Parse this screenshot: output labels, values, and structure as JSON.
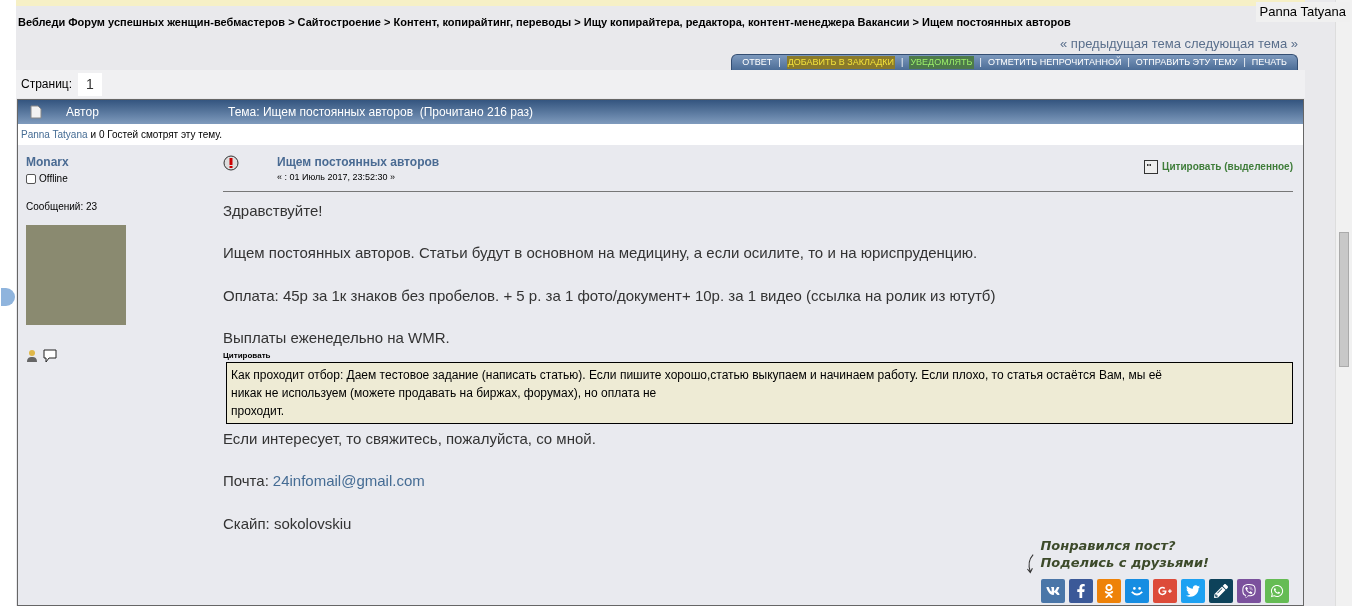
{
  "breadcrumb": "Вебледи Форум успешных женщин-вебмастеров > Сайтостроение > Контент, копирайтинг, переводы > Ищу копирайтера, редактора, контент-менеджера Вакансии > Ищем постоянных авторов",
  "tooltip": "Panna Tatyana",
  "topic_nav": "« предыдущая тема следующая тема »",
  "action_separator": "|",
  "actions": [
    {
      "label": "ОТВЕТ",
      "kind": "plain"
    },
    {
      "label": "ДОБАВИТЬ В ЗАКЛАДКИ",
      "kind": "bookmark"
    },
    {
      "label": "УВЕДОМЛЯТЬ",
      "kind": "notify"
    },
    {
      "label": "ОТМЕТИТЬ НЕПРОЧИТАННОЙ",
      "kind": "plain"
    },
    {
      "label": "ОТПРАВИТЬ ЭТУ ТЕМУ",
      "kind": "plain"
    },
    {
      "label": "ПЕЧАТЬ",
      "kind": "plain"
    }
  ],
  "pages": {
    "label": "Страниц:",
    "current": "1"
  },
  "table_header": {
    "author": "Автор",
    "topic": "Тема: Ищем постоянных авторов  (Прочитано 216 раз)"
  },
  "viewers": {
    "user": "Panna Tatyana",
    "rest": "и 0 Гостей смотрят эту тему."
  },
  "post": {
    "author": "Monarx",
    "online": false,
    "status": "Offline",
    "messages": "Сообщений: 23",
    "title": "Ищем постоянных авторов",
    "date": "« : 01 Июль 2017, 23:52:30 »",
    "quote_action": "Цитировать (выделенное)",
    "paragraphs": [
      "Здравствуйте!",
      "Ищем постоянных авторов. Статьи будут в основном на медицину, а если осилите, то и на юриспруденцию.",
      "Оплата: 45р за 1к знаков без пробелов. + 5 р. за 1 фото/документ+ 10р. за 1 видео (ссылка на ролик из ютутб)",
      "Выплаты еженедельно на WMR."
    ],
    "quote_label": "Цитировать",
    "quote_lines": [
      "Как проходит отбор: Даем тестовое задание (написать статью). Если пишите хорошо,статью выкупаем и начинаем работу. Если плохо, то статья остаётся Вам, мы её",
      "никак не используем (можете продавать на биржах, форумах), но оплата не",
      "проходит."
    ],
    "after": [
      "Если интересует, то свяжитесь, пожалуйста, со мной."
    ],
    "mail_label": "Почта:",
    "mail": "24infomail@gmail.com",
    "skype": "Скайп: sokolovskiu"
  },
  "share": {
    "caption_lines": [
      "Понравился пост?",
      "Поделись с друзьями!"
    ],
    "buttons": [
      {
        "kind": "vk",
        "color": "#4a76a8"
      },
      {
        "kind": "facebook",
        "color": "#3b5998"
      },
      {
        "kind": "odnoklassniki",
        "color": "#ee8208"
      },
      {
        "kind": "mailru",
        "color": "#168de2"
      },
      {
        "kind": "googleplus",
        "color": "#dd4b39"
      },
      {
        "kind": "twitter",
        "color": "#1da1f2"
      },
      {
        "kind": "livejournal",
        "color": "#0d425a"
      },
      {
        "kind": "viber",
        "color": "#7b519d"
      },
      {
        "kind": "whatsapp",
        "color": "#65bc54"
      }
    ]
  }
}
